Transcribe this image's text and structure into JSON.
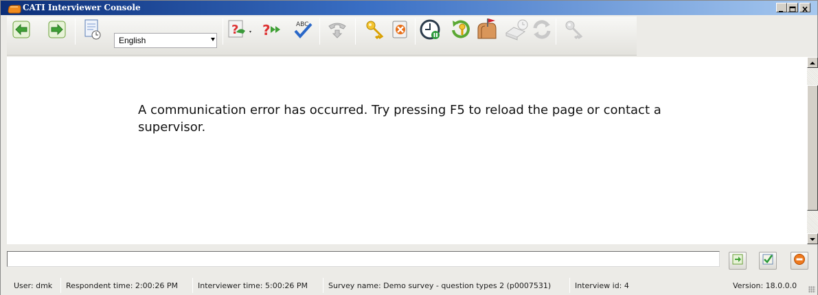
{
  "window": {
    "title": "CATI Interviewer Console"
  },
  "toolbar": {
    "language": {
      "selected": "English"
    },
    "buttons": [
      {
        "name": "back-button",
        "icon": "arrow-left-icon",
        "enabled": true
      },
      {
        "name": "forward-button",
        "icon": "arrow-right-icon",
        "enabled": true
      },
      {
        "name": "document-history-button",
        "icon": "document-clock-icon",
        "enabled": true
      },
      {
        "name": "help-button",
        "icon": "help-question-icon",
        "enabled": true
      },
      {
        "name": "skip-button",
        "icon": "question-fastforward-icon",
        "enabled": true
      },
      {
        "name": "spellcheck-button",
        "icon": "abc-check-icon",
        "enabled": true
      },
      {
        "name": "hangup-button",
        "icon": "phone-hangup-icon",
        "enabled": false
      },
      {
        "name": "key-button",
        "icon": "key-icon",
        "enabled": true
      },
      {
        "name": "cancel-button",
        "icon": "cancel-doc-icon",
        "enabled": true
      },
      {
        "name": "pause-timer-button",
        "icon": "clock-pause-icon",
        "enabled": true
      },
      {
        "name": "refresh-key-button",
        "icon": "refresh-key-icon",
        "enabled": true
      },
      {
        "name": "mailbox-button",
        "icon": "mailbox-icon",
        "enabled": true
      },
      {
        "name": "appointment-button",
        "icon": "book-clock-icon",
        "enabled": false
      },
      {
        "name": "sync-button",
        "icon": "sync-icon",
        "enabled": false
      },
      {
        "name": "key-disabled-button",
        "icon": "key-icon",
        "enabled": false
      }
    ]
  },
  "content": {
    "message": "A communication error has occurred. Try pressing F5 to reload the page or contact a supervisor."
  },
  "input": {
    "value": ""
  },
  "input_buttons": [
    {
      "name": "go-button",
      "icon": "go-arrow-icon"
    },
    {
      "name": "accept-button",
      "icon": "checkmark-icon"
    },
    {
      "name": "stop-button",
      "icon": "stop-icon"
    }
  ],
  "statusbar": {
    "user": "User:  dmk",
    "respondent_time": "Respondent time:  2:00:26 PM",
    "interviewer_time": "Interviewer time:  5:00:26 PM",
    "survey_name": "Survey name:  Demo survey - question types 2 (p0007531)",
    "interview_id": "Interview id:  4",
    "version": "Version:  18.0.0.0"
  },
  "colors": {
    "titlebar_start": "#0b2e78",
    "titlebar_end": "#a6c8ef",
    "chrome": "#ecebe7",
    "content_bg": "#ffffff"
  }
}
